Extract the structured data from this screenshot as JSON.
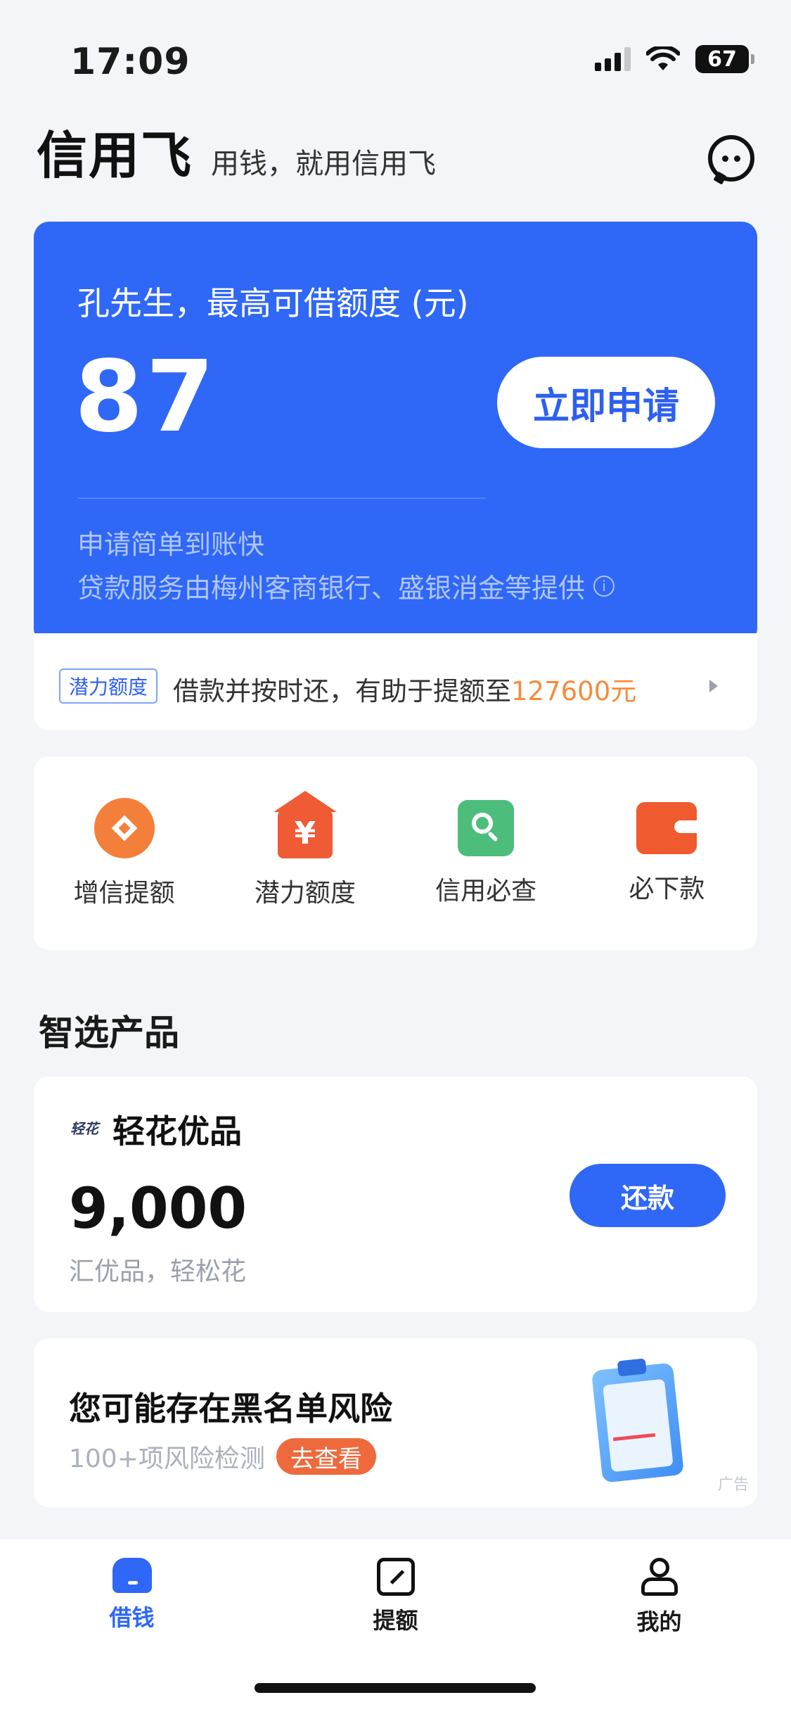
{
  "status_bar": {
    "time": "17:09",
    "battery": "67"
  },
  "header": {
    "logo": "信用飞",
    "slogan": "用钱，就用信用飞"
  },
  "hero": {
    "greeting": "孔先生，最高可借额度 (元)",
    "amount": "87",
    "apply_button": "立即申请",
    "line1": "申请简单到账快",
    "line2": "贷款服务由梅州客商银行、盛银消金等提供"
  },
  "potential": {
    "tag": "潜力额度",
    "text": "借款并按时还，有助于提额至",
    "amount": "127600元"
  },
  "quick_entries": [
    {
      "label": "增信提额",
      "icon": "coin-icon"
    },
    {
      "label": "潜力额度",
      "icon": "yuan-house-icon"
    },
    {
      "label": "信用必查",
      "icon": "search-icon"
    },
    {
      "label": "必下款",
      "icon": "wallet-icon"
    }
  ],
  "section": {
    "title": "智选产品"
  },
  "product": {
    "logo_text": "轻花",
    "name": "轻花优品",
    "amount": "9,000",
    "desc": "汇优品，轻松花",
    "button": "还款"
  },
  "risk_card": {
    "title": "您可能存在黑名单风险",
    "subtitle": "100+项风险检测",
    "pill": "去查看",
    "ad": "广告"
  },
  "tabbar": [
    {
      "label": "借钱",
      "active": true
    },
    {
      "label": "提额",
      "active": false
    },
    {
      "label": "我的",
      "active": false
    }
  ],
  "colors": {
    "brand_blue": "#2f67f6",
    "accent_orange": "#f58b3b",
    "background": "#f4f5f9"
  }
}
